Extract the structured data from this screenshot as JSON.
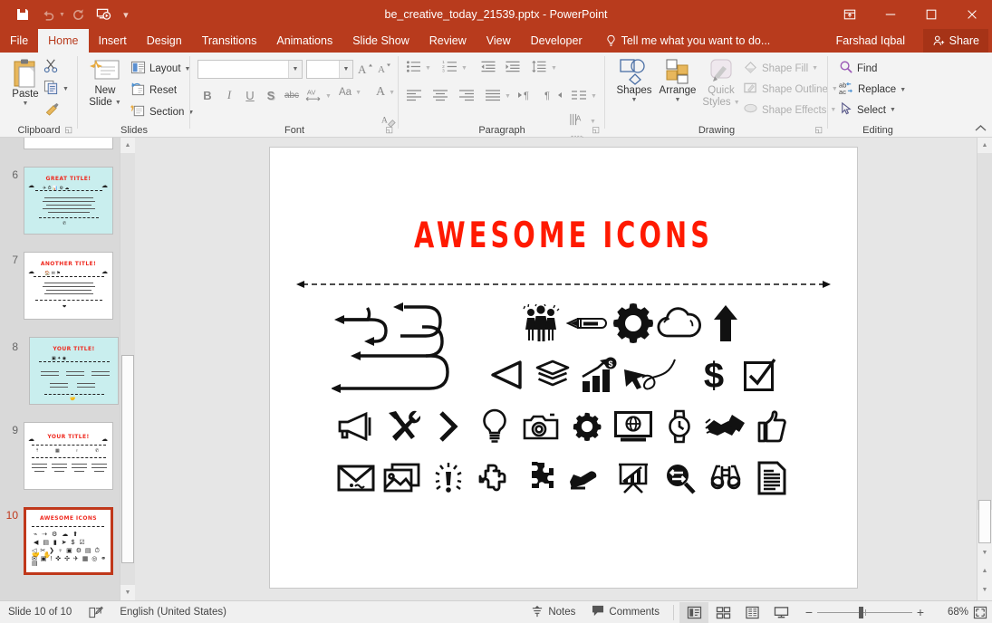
{
  "window": {
    "title": "be_creative_today_21539.pptx - PowerPoint",
    "accent": "#b83b1d",
    "quick_access": [
      {
        "name": "save-icon",
        "label": "Save",
        "disabled": false
      },
      {
        "name": "undo-icon",
        "label": "Undo",
        "disabled": true
      },
      {
        "name": "redo-icon",
        "label": "Repeat",
        "disabled": true
      },
      {
        "name": "start-slideshow-icon",
        "label": "Start From Beginning",
        "disabled": false
      },
      {
        "name": "customize-qat-icon",
        "label": "Customize Quick Access Toolbar",
        "disabled": false
      }
    ],
    "controls": [
      {
        "name": "ribbon-display-options-icon",
        "label": "Ribbon Display Options"
      },
      {
        "name": "minimize-icon",
        "label": "Minimize"
      },
      {
        "name": "maximize-icon",
        "label": "Maximize"
      },
      {
        "name": "close-icon",
        "label": "Close"
      }
    ]
  },
  "tabs": [
    {
      "label": "File",
      "active": false
    },
    {
      "label": "Home",
      "active": true
    },
    {
      "label": "Insert",
      "active": false
    },
    {
      "label": "Design",
      "active": false
    },
    {
      "label": "Transitions",
      "active": false
    },
    {
      "label": "Animations",
      "active": false
    },
    {
      "label": "Slide Show",
      "active": false
    },
    {
      "label": "Review",
      "active": false
    },
    {
      "label": "View",
      "active": false
    },
    {
      "label": "Developer",
      "active": false
    }
  ],
  "tellme": {
    "label": "Tell me what you want to do...",
    "icon": "lightbulb-icon"
  },
  "account": {
    "name": "Farshad Iqbal"
  },
  "share": {
    "label": "Share",
    "icon": "share-person-icon"
  },
  "ribbon": {
    "groups": [
      {
        "label": "Clipboard",
        "dialog_launcher": true
      },
      {
        "label": "Slides",
        "dialog_launcher": false
      },
      {
        "label": "Font",
        "dialog_launcher": true
      },
      {
        "label": "Paragraph",
        "dialog_launcher": true
      },
      {
        "label": "Drawing",
        "dialog_launcher": true
      },
      {
        "label": "Editing",
        "dialog_launcher": false
      }
    ],
    "clipboard": {
      "paste": "Paste",
      "cut": "Cut",
      "copy": "Copy",
      "format_painter": "Format Painter"
    },
    "slides": {
      "new_slide": "New\nSlide",
      "new_slide_line1": "New",
      "new_slide_line2": "Slide",
      "layout": "Layout",
      "reset": "Reset",
      "section": "Section"
    },
    "font": {
      "font_name_value": "",
      "font_name_placeholder": "",
      "font_size_value": "",
      "grow_font": "Increase Font Size",
      "shrink_font": "Decrease Font Size",
      "clear_formatting": "Clear All Formatting",
      "bold": "B",
      "italic": "I",
      "underline": "U",
      "shadow": "S",
      "strikethrough": "abc",
      "character_spacing": "AV",
      "change_case": "Aa",
      "font_color": "A"
    },
    "paragraph": {
      "bullets": "Bullets",
      "numbering": "Numbering",
      "decrease_indent": "Decrease List Level",
      "increase_indent": "Increase List Level",
      "line_spacing": "Line Spacing",
      "align_left": "Align Left",
      "center": "Center",
      "align_right": "Align Right",
      "justify": "Justify",
      "columns": "Add or Remove Columns",
      "text_direction": "Text Direction",
      "align_text": "Align Text",
      "convert_smartart": "Convert to SmartArt",
      "ltr": "Left-to-Right",
      "rtl": "Right-to-Left"
    },
    "drawing": {
      "shapes": "Shapes",
      "arrange": "Arrange",
      "quick_styles_line1": "Quick",
      "quick_styles_line2": "Styles",
      "shape_fill": "Shape Fill",
      "shape_outline": "Shape Outline",
      "shape_effects": "Shape Effects"
    },
    "editing": {
      "find": "Find",
      "replace": "Replace",
      "select": "Select"
    },
    "collapse": "Collapse the Ribbon"
  },
  "thumbnails": [
    {
      "number": "5",
      "title": "",
      "selected": false,
      "bg": "white",
      "partial": true
    },
    {
      "number": "6",
      "title": "GREAT TITLE!",
      "selected": false,
      "bg": "teal",
      "layout": "frame"
    },
    {
      "number": "7",
      "title": "ANOTHER TITLE!",
      "selected": false,
      "bg": "white",
      "layout": "text"
    },
    {
      "number": "8",
      "title": "YOUR TITLE!",
      "selected": false,
      "bg": "teal",
      "layout": "cards"
    },
    {
      "number": "9",
      "title": "YOUR TITLE!",
      "selected": false,
      "bg": "white",
      "layout": "timeline"
    },
    {
      "number": "10",
      "title": "AWESOME ICONS",
      "selected": true,
      "bg": "white",
      "layout": "icons"
    }
  ],
  "slide": {
    "title": "AWESOME ICONS",
    "title_color": "#ff1a00",
    "divider": "double-headed-dashed-arrow",
    "icon_rows": [
      [
        {
          "name": "swoosh-arrows-icon",
          "label": "Curved swoosh arrows"
        },
        {
          "name": "team-people-icon",
          "label": "Team of people"
        },
        {
          "name": "pencil-icon",
          "label": "Pencil"
        },
        {
          "name": "gear-icon",
          "label": "Gear / settings"
        },
        {
          "name": "cloud-icon",
          "label": "Cloud"
        },
        {
          "name": "up-arrow-icon",
          "label": "Up arrow"
        }
      ],
      [
        {
          "name": "play-left-triangle-icon",
          "label": "Left-pointing triangle"
        },
        {
          "name": "layers-stack-icon",
          "label": "Stacked layers"
        },
        {
          "name": "bar-chart-dollar-icon",
          "label": "Growth bar chart with dollar"
        },
        {
          "name": "cursor-swirl-icon",
          "label": "Cursor with swirl line"
        },
        {
          "name": "dollar-sign-icon",
          "label": "Dollar sign"
        },
        {
          "name": "checkbox-checked-icon",
          "label": "Checked checkbox"
        }
      ],
      [
        {
          "name": "megaphone-icon",
          "label": "Megaphone"
        },
        {
          "name": "tools-hammer-wrench-icon",
          "label": "Hammer and wrench"
        },
        {
          "name": "chevron-right-icon",
          "label": "Chevron right"
        },
        {
          "name": "lightbulb-icon",
          "label": "Light bulb"
        },
        {
          "name": "camera-icon",
          "label": "Camera"
        },
        {
          "name": "gear-small-icon",
          "label": "Small gear"
        },
        {
          "name": "monitor-globe-icon",
          "label": "Monitor with globe"
        },
        {
          "name": "wristwatch-icon",
          "label": "Wristwatch"
        },
        {
          "name": "handshake-icon",
          "label": "Handshake"
        },
        {
          "name": "thumbs-up-icon",
          "label": "Thumbs up"
        }
      ],
      [
        {
          "name": "envelope-icon",
          "label": "Envelope mail"
        },
        {
          "name": "photos-icon",
          "label": "Photos / images"
        },
        {
          "name": "exclamation-alert-icon",
          "label": "Exclamation alert"
        },
        {
          "name": "puzzle-piece-icon",
          "label": "Puzzle piece"
        },
        {
          "name": "puzzle-cross-icon",
          "label": "Interlocking puzzle"
        },
        {
          "name": "airplane-icon",
          "label": "Airplane"
        },
        {
          "name": "presentation-easel-icon",
          "label": "Presentation easel chart"
        },
        {
          "name": "magnifier-exchange-icon",
          "label": "Magnifier with arrows"
        },
        {
          "name": "binoculars-icon",
          "label": "Binoculars"
        },
        {
          "name": "document-lines-icon",
          "label": "Document with text lines"
        }
      ]
    ]
  },
  "statusbar": {
    "slide_counter": "Slide 10 of 10",
    "language_icon": "spellcheck-icon",
    "language": "English (United States)",
    "notes": "Notes",
    "comments": "Comments",
    "views": [
      {
        "name": "normal-view-button",
        "label": "Normal",
        "active": true
      },
      {
        "name": "slide-sorter-button",
        "label": "Slide Sorter",
        "active": false
      },
      {
        "name": "reading-view-button",
        "label": "Reading View",
        "active": false
      },
      {
        "name": "slideshow-button",
        "label": "Slide Show",
        "active": false
      }
    ],
    "zoom_out": "−",
    "zoom_in": "+",
    "zoom_level": "68%",
    "fit_slide": "Fit slide to current window"
  }
}
